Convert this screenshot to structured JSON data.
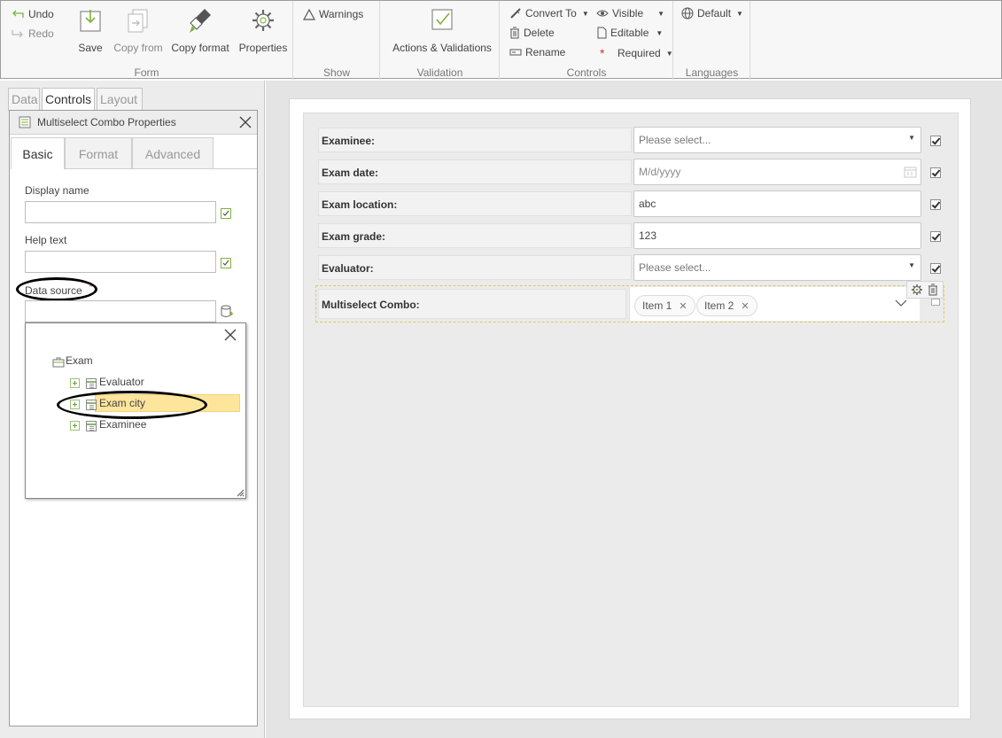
{
  "ribbon": {
    "undo": "Undo",
    "redo": "Redo",
    "save": "Save",
    "copy_from": "Copy from",
    "copy_format": "Copy format",
    "properties": "Properties",
    "form_group": "Form",
    "warnings": "Warnings",
    "show_group": "Show",
    "actions_validations": "Actions & Validations",
    "validation_group": "Validation",
    "convert_to": "Convert To",
    "delete": "Delete",
    "rename": "Rename",
    "visible": "Visible",
    "editable": "Editable",
    "required": "Required",
    "controls_group": "Controls",
    "language_default": "Default",
    "languages_group": "Languages"
  },
  "left_tabs": [
    "Data",
    "Controls",
    "Layout"
  ],
  "properties_panel": {
    "title": "Multiselect Combo Properties",
    "tabs": [
      "Basic",
      "Format",
      "Advanced"
    ],
    "display_name_label": "Display name",
    "display_name_value": "",
    "help_text_label": "Help text",
    "help_text_value": "",
    "data_source_label": "Data source",
    "required_marker": "*"
  },
  "data_source_popup": {
    "root": "Exam",
    "items": [
      "Evaluator",
      "Exam city",
      "Examinee"
    ],
    "selected": "Exam city"
  },
  "form": {
    "rows": [
      {
        "label": "Examinee:",
        "value": "Please select...",
        "kind": "dropdown"
      },
      {
        "label": "Exam date:",
        "value": "M/d/yyyy",
        "kind": "date"
      },
      {
        "label": "Exam location:",
        "value": "abc",
        "kind": "text"
      },
      {
        "label": "Exam grade:",
        "value": "123",
        "kind": "text"
      },
      {
        "label": "Evaluator:",
        "value": "Please select...",
        "kind": "dropdown"
      }
    ],
    "multiselect": {
      "label": "Multiselect Combo:",
      "tags": [
        "Item 1",
        "Item 2"
      ]
    }
  },
  "colors": {
    "accent_green": "#7fb23a",
    "highlight": "#fde59c",
    "required_red": "#d9312b"
  }
}
